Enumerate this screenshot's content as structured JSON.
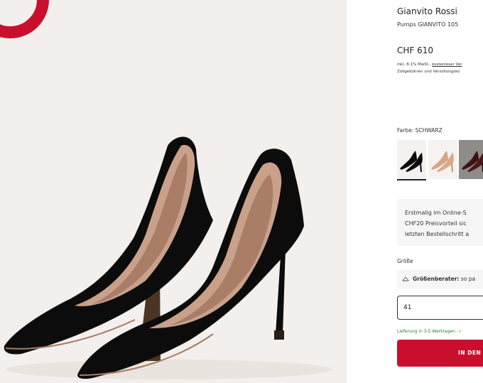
{
  "product": {
    "brand": "Gianvito Rossi",
    "model": "Pumps GIANVITO 105",
    "price": "CHF 610",
    "tax_note_prefix": "inkl. 8.1% MwSt., ",
    "tax_note_link": "kostenloser Ver",
    "tax_note_line2": "Zollgebühren und Verzollungsko"
  },
  "colors": {
    "label": "Farbe: SCHWARZ",
    "swatches": [
      {
        "name": "Schwarz",
        "selected": true
      },
      {
        "name": "Nude",
        "selected": false
      },
      {
        "name": "Bordeaux",
        "selected": false
      }
    ]
  },
  "promo": {
    "line1": "Erstmalig im Online-S",
    "line2": "CHF20 Preisvorteil sic",
    "line3": "letzten Bestellschritt a"
  },
  "size": {
    "label": "Größe",
    "advisor_label": "Größenberater:",
    "advisor_value": "so pa",
    "selected": "41"
  },
  "delivery": {
    "text": "Lieferung in 3-5 Werktagen - r"
  },
  "cart": {
    "label": "IN DEN"
  },
  "theme": {
    "accent": "#c8102e",
    "panel_bg": "#f3efec",
    "success": "#2e7d32"
  }
}
